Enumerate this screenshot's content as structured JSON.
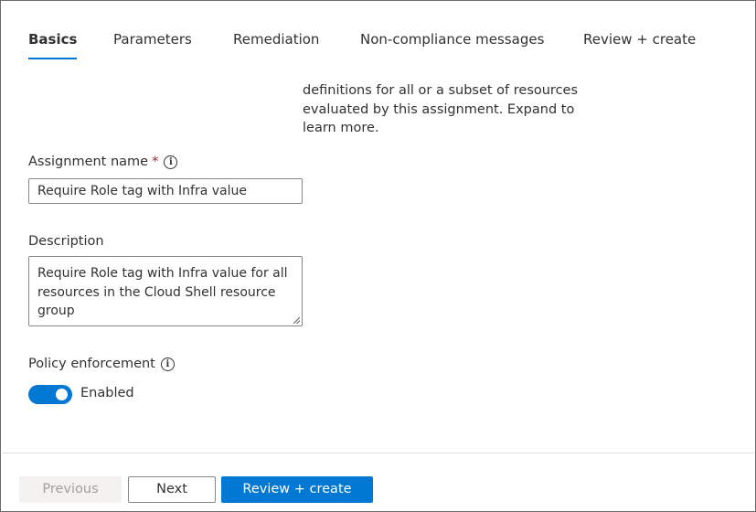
{
  "tabs": [
    {
      "label": "Basics",
      "active": true
    },
    {
      "label": "Parameters",
      "active": false
    },
    {
      "label": "Remediation",
      "active": false
    },
    {
      "label": "Non-compliance messages",
      "active": false
    },
    {
      "label": "Review + create",
      "active": false
    }
  ],
  "info_text": "definitions for all or a subset of resources evaluated by this assignment. Expand to learn more.",
  "assignment_name": {
    "label": "Assignment name",
    "required_marker": "*",
    "value": "Require Role tag with Infra value"
  },
  "description": {
    "label": "Description",
    "value": "Require Role tag with Infra value for all resources in the Cloud Shell resource group"
  },
  "policy_enforcement": {
    "label": "Policy enforcement",
    "state_label": "Enabled",
    "enabled": true
  },
  "icons": {
    "info": "info-icon",
    "info_glyph": "i"
  },
  "footer": {
    "previous_label": "Previous",
    "next_label": "Next",
    "review_label": "Review + create"
  },
  "colors": {
    "accent": "#0078d4",
    "required": "#a4262c",
    "disabled_text": "#a19f9d"
  }
}
